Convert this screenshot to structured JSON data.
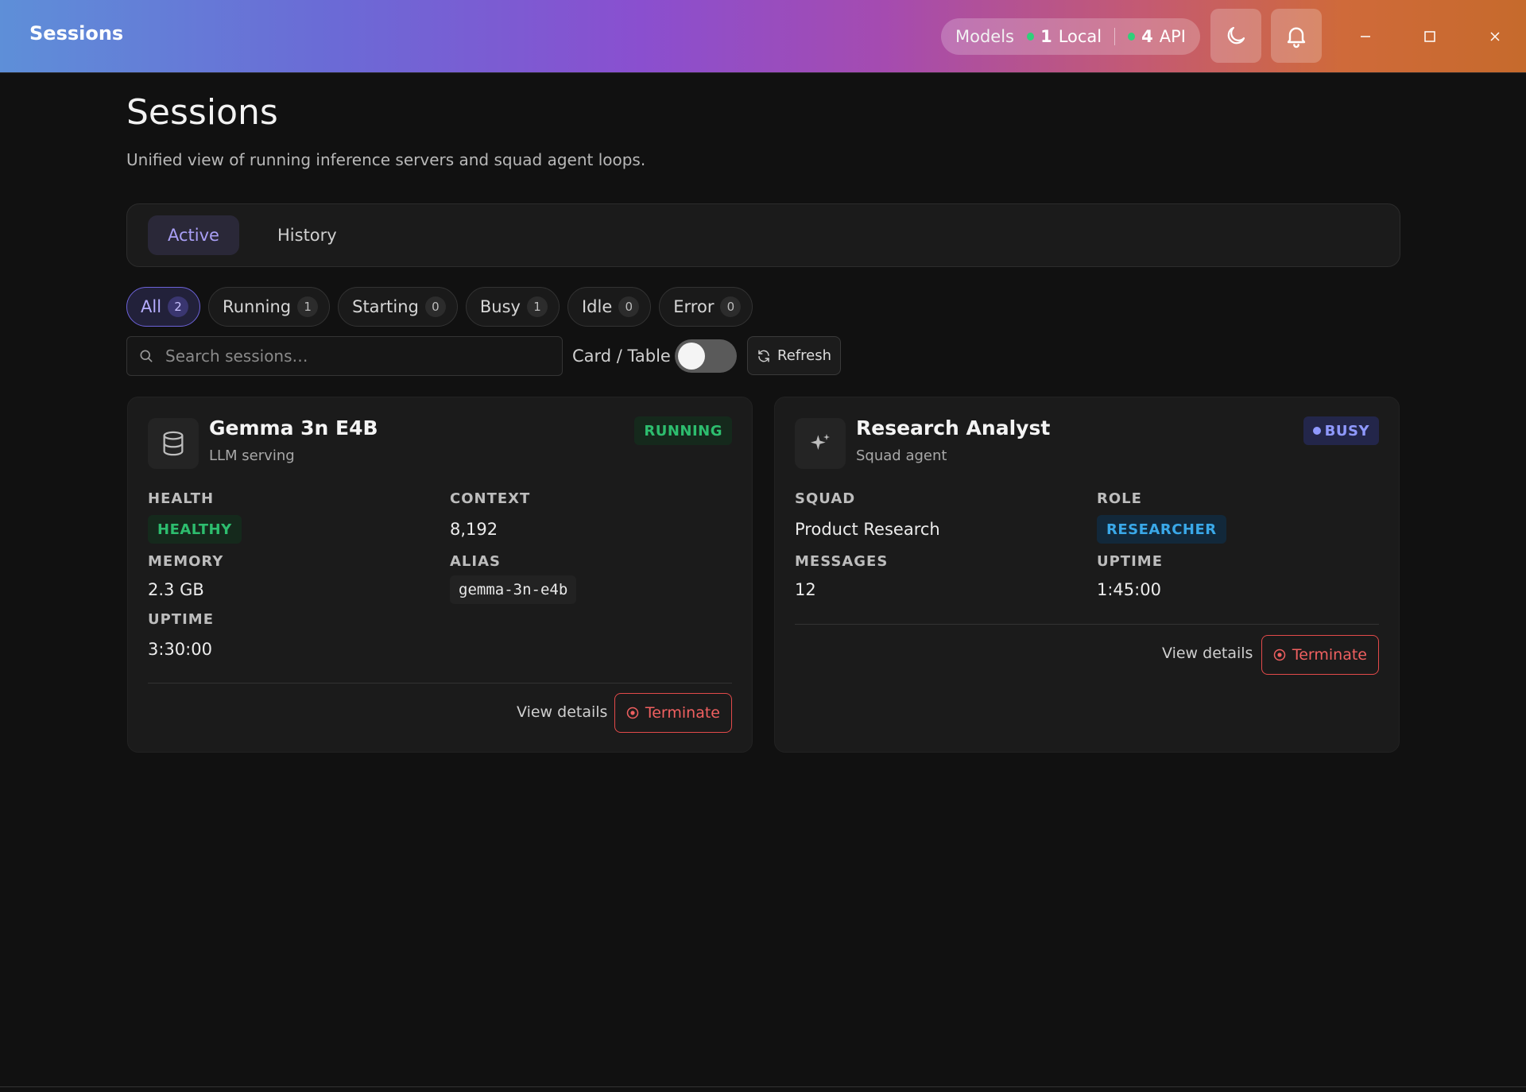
{
  "titlebar": {
    "app_title": "Sessions",
    "models": {
      "label": "Models",
      "local_count": "1",
      "local_label": "Local",
      "api_count": "4",
      "api_label": "API",
      "status_color": "#2fd07a"
    },
    "theme_icon": "moon-icon",
    "notifications_icon": "bell-icon"
  },
  "page": {
    "title": "Sessions",
    "subtitle": "Unified view of running inference servers and squad agent loops."
  },
  "tabs": [
    {
      "label": "Active",
      "active": true
    },
    {
      "label": "History",
      "active": false
    }
  ],
  "filters": [
    {
      "label": "All",
      "count": "2",
      "active": true
    },
    {
      "label": "Running",
      "count": "1"
    },
    {
      "label": "Starting",
      "count": "0"
    },
    {
      "label": "Busy",
      "count": "1"
    },
    {
      "label": "Idle",
      "count": "0"
    },
    {
      "label": "Error",
      "count": "0"
    }
  ],
  "toolbar": {
    "search_placeholder": "Search sessions…",
    "view_label": "Card / Table",
    "refresh_label": "Refresh"
  },
  "cards": [
    {
      "title": "Gemma 3n E4B",
      "subtitle": "LLM serving",
      "icon": "database-icon",
      "status": "RUNNING",
      "fields": {
        "health_label": "HEALTH",
        "health": "HEALTHY",
        "context_label": "CONTEXT",
        "context": "8,192",
        "memory_label": "MEMORY",
        "memory": "2.3 GB",
        "alias_label": "ALIAS",
        "alias": "gemma-3n-e4b",
        "uptime_label": "UPTIME",
        "uptime": "3:30:00"
      },
      "view_label": "View details",
      "terminate_label": "Terminate"
    },
    {
      "title": "Research Analyst",
      "subtitle": "Squad agent",
      "icon": "sparkle-icon",
      "status": "BUSY",
      "fields": {
        "squad_label": "SQUAD",
        "squad": "Product Research",
        "role_label": "ROLE",
        "role": "RESEARCHER",
        "messages_label": "MESSAGES",
        "messages": "12",
        "uptime_label": "UPTIME",
        "uptime": "1:45:00"
      },
      "view_label": "View details",
      "terminate_label": "Terminate"
    }
  ]
}
